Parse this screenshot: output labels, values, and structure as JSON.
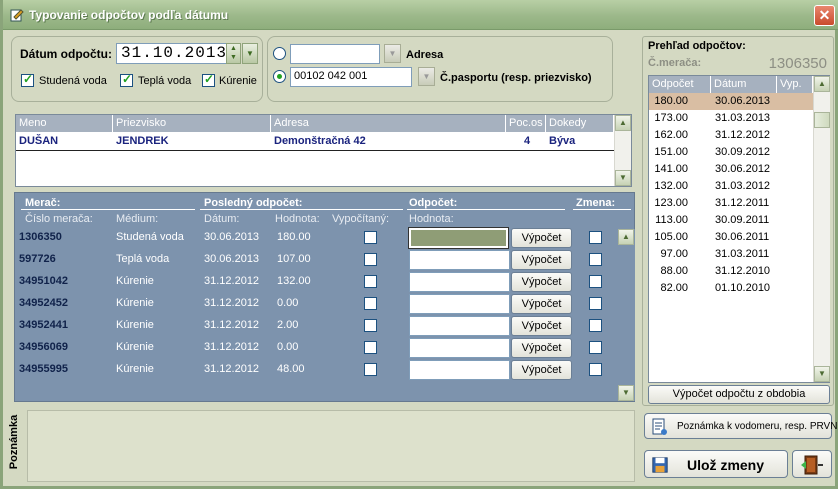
{
  "window": {
    "title": "Typovanie odpočtov podľa dátumu",
    "close_glyph": "✕"
  },
  "filter": {
    "date_label": "Dátum odpočtu:",
    "date_value": "31.10.2013",
    "checks": [
      {
        "label": "Studená voda",
        "checked": true
      },
      {
        "label": "Teplá voda",
        "checked": true
      },
      {
        "label": "Kúrenie",
        "checked": true
      }
    ],
    "adresa_label": "Adresa",
    "adresa_value": "",
    "pasport_label": "Č.pasportu (resp. priezvisko)",
    "pasport_value": "00102 042 001",
    "selected_radio": "pasport"
  },
  "people": {
    "headers": [
      "Meno",
      "Priezvisko",
      "Adresa",
      "Poc.os",
      "Dokedy"
    ],
    "rows": [
      [
        "DUŠAN",
        "JENDREK",
        "Demonštračná 42",
        "4",
        "Býva"
      ]
    ]
  },
  "meters": {
    "group_merac": "Merač:",
    "group_posledny": "Posledný odpočet:",
    "group_odpocet": "Odpočet:",
    "group_zmena": "Zmena:",
    "sub_cislo": "Číslo merača:",
    "sub_medium": "Médium:",
    "sub_datum": "Dátum:",
    "sub_hodnota": "Hodnota:",
    "sub_vypocitany": "Vypočítaný:",
    "sub_hodnota2": "Hodnota:",
    "compute_label": "Výpočet",
    "rows": [
      {
        "cislo": "1306350",
        "medium": "Studená voda",
        "datum": "30.06.2013",
        "hodnota": "180.00"
      },
      {
        "cislo": "597726",
        "medium": "Teplá voda",
        "datum": "30.06.2013",
        "hodnota": "107.00"
      },
      {
        "cislo": "34951042",
        "medium": "Kúrenie",
        "datum": "31.12.2012",
        "hodnota": "132.00"
      },
      {
        "cislo": "34952452",
        "medium": "Kúrenie",
        "datum": "31.12.2012",
        "hodnota": "0.00"
      },
      {
        "cislo": "34952441",
        "medium": "Kúrenie",
        "datum": "31.12.2012",
        "hodnota": "2.00"
      },
      {
        "cislo": "34956069",
        "medium": "Kúrenie",
        "datum": "31.12.2012",
        "hodnota": "0.00"
      },
      {
        "cislo": "34955995",
        "medium": "Kúrenie",
        "datum": "31.12.2012",
        "hodnota": "48.00"
      }
    ]
  },
  "overview": {
    "title": "Prehľad odpočtov:",
    "meter_label": "Č.merača:",
    "meter_value": "1306350",
    "headers": [
      "Odpočet",
      "Dátum",
      "Vyp."
    ],
    "rows": [
      [
        "180.00",
        "30.06.2013"
      ],
      [
        "173.00",
        "31.03.2013"
      ],
      [
        "162.00",
        "31.12.2012"
      ],
      [
        "151.00",
        "30.09.2012"
      ],
      [
        "141.00",
        "30.06.2012"
      ],
      [
        "132.00",
        "31.03.2012"
      ],
      [
        "123.00",
        "31.12.2011"
      ],
      [
        "113.00",
        "30.09.2011"
      ],
      [
        "105.00",
        "30.06.2011"
      ],
      [
        "97.00",
        "31.03.2011"
      ],
      [
        "88.00",
        "31.12.2010"
      ],
      [
        "82.00",
        "01.10.2010"
      ]
    ],
    "calc_button": "Výpočet odpočtu z obdobia"
  },
  "note": {
    "label": "Poznámka",
    "value": ""
  },
  "buttons": {
    "note_button": "Poznámka k vodomeru, resp. PRVN",
    "save_button": "Ulož zmeny"
  },
  "colors": {
    "selected_row": "#d9bea3",
    "input_highlight": "#8f9d76",
    "meter_panel": "#7d93ad"
  }
}
